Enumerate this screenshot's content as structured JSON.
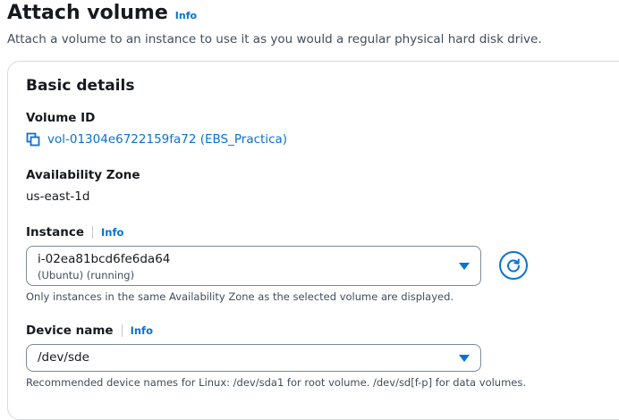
{
  "header": {
    "title": "Attach volume",
    "info": "Info",
    "description": "Attach a volume to an instance to use it as you would a regular physical hard disk drive."
  },
  "panel": {
    "title": "Basic details",
    "volume_id": {
      "label": "Volume ID",
      "link": "vol-01304e6722159fa72 (EBS_Practica)",
      "icon": "copy-icon"
    },
    "availability_zone": {
      "label": "Availability Zone",
      "value": "us-east-1d"
    },
    "instance": {
      "label": "Instance",
      "info": "Info",
      "selected_value": "i-02ea81bcd6fe6da64",
      "selected_sub": "(Ubuntu) (running)",
      "hint": "Only instances in the same Availability Zone as the selected volume are displayed.",
      "refresh_icon": "refresh-icon"
    },
    "device_name": {
      "label": "Device name",
      "info": "Info",
      "selected_value": "/dev/sde",
      "hint": "Recommended device names for Linux: /dev/sda1 for root volume. /dev/sd[f-p] for data volumes."
    }
  },
  "colors": {
    "link": "#0972d3",
    "text": "#16191f",
    "secondary": "#414d5c",
    "border": "#7d8998"
  }
}
